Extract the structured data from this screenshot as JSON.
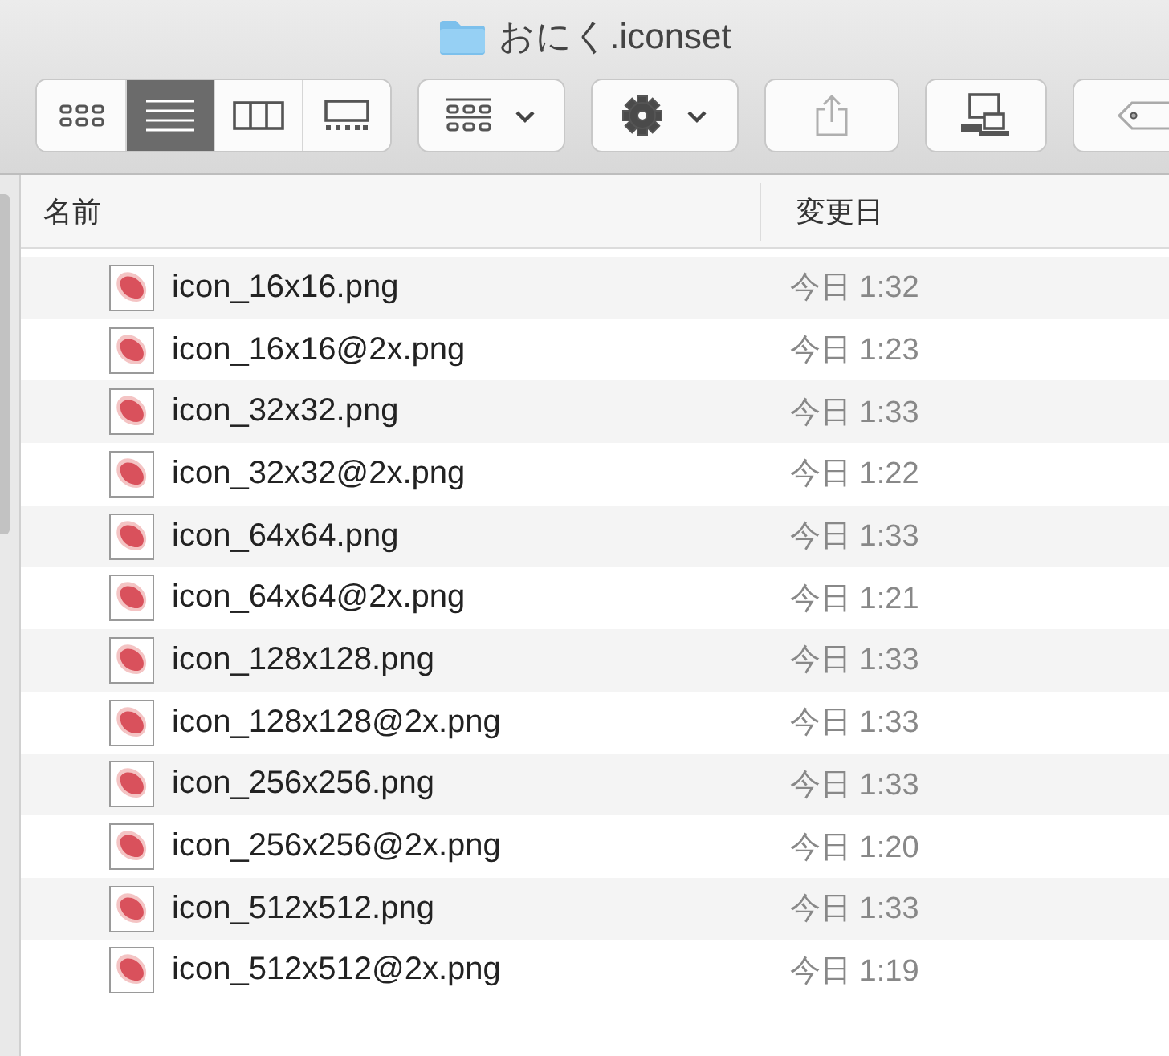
{
  "window": {
    "title": "おにく.iconset"
  },
  "view_modes": [
    {
      "kind": "icons",
      "selected": false
    },
    {
      "kind": "list",
      "selected": true
    },
    {
      "kind": "columns",
      "selected": false
    },
    {
      "kind": "gallery",
      "selected": false
    }
  ],
  "toolbar": [
    {
      "kind": "arrange",
      "disabled": false
    },
    {
      "kind": "action",
      "disabled": false
    },
    {
      "kind": "share",
      "disabled": true
    },
    {
      "kind": "connect",
      "disabled": false
    },
    {
      "kind": "tag",
      "disabled": false
    }
  ],
  "table": {
    "columns": [
      "名前",
      "変更日"
    ],
    "rows": [
      {
        "name": "icon_16x16.png",
        "modified": "今日 1:32"
      },
      {
        "name": "icon_16x16@2x.png",
        "modified": "今日 1:23"
      },
      {
        "name": "icon_32x32.png",
        "modified": "今日 1:33"
      },
      {
        "name": "icon_32x32@2x.png",
        "modified": "今日 1:22"
      },
      {
        "name": "icon_64x64.png",
        "modified": "今日 1:33"
      },
      {
        "name": "icon_64x64@2x.png",
        "modified": "今日 1:21"
      },
      {
        "name": "icon_128x128.png",
        "modified": "今日 1:33"
      },
      {
        "name": "icon_128x128@2x.png",
        "modified": "今日 1:33"
      },
      {
        "name": "icon_256x256.png",
        "modified": "今日 1:33"
      },
      {
        "name": "icon_256x256@2x.png",
        "modified": "今日 1:20"
      },
      {
        "name": "icon_512x512.png",
        "modified": "今日 1:33"
      },
      {
        "name": "icon_512x512@2x.png",
        "modified": "今日 1:19"
      }
    ]
  }
}
